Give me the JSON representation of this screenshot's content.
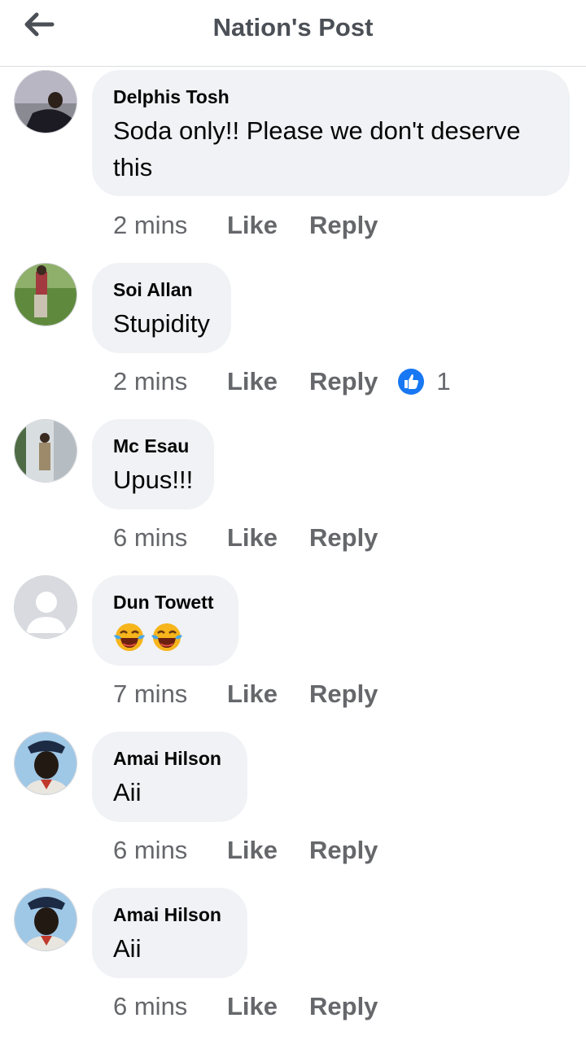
{
  "header": {
    "title": "Nation's Post"
  },
  "actions": {
    "like": "Like",
    "reply": "Reply"
  },
  "comments": [
    {
      "author": "Delphis Tosh",
      "text": "Soda only!! Please we don't deserve this",
      "time": "2 mins"
    },
    {
      "author": "Soi Allan",
      "text": "Stupidity",
      "time": "2 mins",
      "reaction_count": "1"
    },
    {
      "author": "Mc Esau",
      "text": "Upus!!!",
      "time": "6 mins"
    },
    {
      "author": "Dun Towett",
      "emojis": [
        "laughing-crying-emoji",
        "laughing-crying-emoji"
      ],
      "time": "7 mins"
    },
    {
      "author": "Amai Hilson",
      "text": "Aii",
      "time": "6 mins"
    },
    {
      "author": "Amai Hilson",
      "text": "Aii",
      "time": "6 mins"
    }
  ],
  "colors": {
    "bubble": "#f0f2f5",
    "meta": "#65676b",
    "like_blue": "#1877f2"
  }
}
